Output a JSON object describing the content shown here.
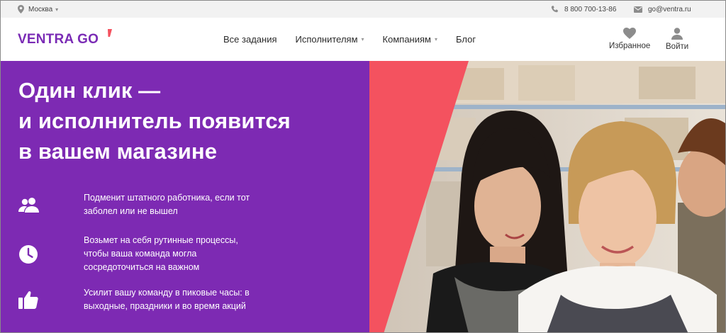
{
  "topbar": {
    "city": "Москва",
    "phone": "8 800 700-13-86",
    "email": "go@ventra.ru"
  },
  "header": {
    "logo_text": "VENTRA GO",
    "nav": [
      {
        "label": "Все задания",
        "has_dropdown": false
      },
      {
        "label": "Исполнителям",
        "has_dropdown": true
      },
      {
        "label": "Компаниям",
        "has_dropdown": true
      },
      {
        "label": "Блог",
        "has_dropdown": false
      }
    ],
    "favorites_label": "Избранное",
    "login_label": "Войти"
  },
  "hero": {
    "headline_lines": [
      "Один клик —",
      "и исполнитель появится",
      "в вашем магазине"
    ],
    "features": [
      {
        "icon": "people-icon",
        "lines": [
          "Подменит штатного работника, если тот",
          "заболел или не вышел"
        ]
      },
      {
        "icon": "clock-icon",
        "lines": [
          "Возьмет на себя рутинные процессы,",
          "чтобы ваша команда могла",
          "сосредоточиться на важном"
        ]
      },
      {
        "icon": "thumbs-up-icon",
        "lines": [
          "Усилит вашу команду в пиковые часы: в",
          "выходные, праздники и во время акций"
        ]
      }
    ]
  },
  "colors": {
    "brand_purple": "#7d2ab3",
    "accent_coral": "#f4525f",
    "logo_purple": "#7a2bb5",
    "topbar_bg": "#f2f2f2"
  }
}
